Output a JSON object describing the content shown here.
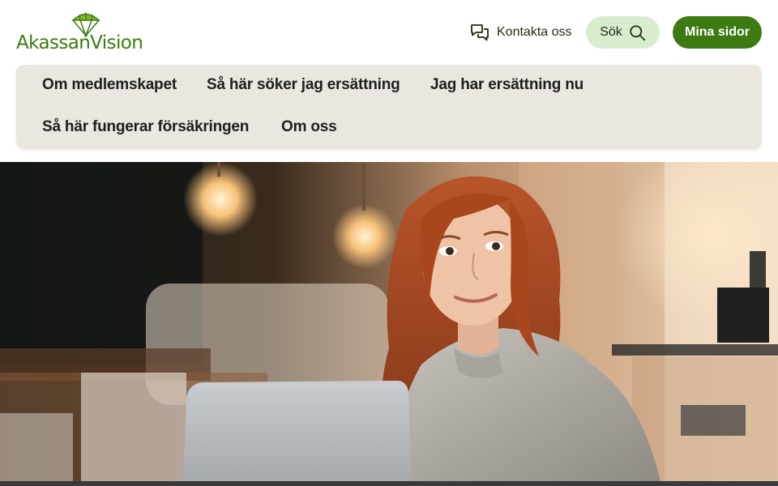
{
  "brand": {
    "name": "AkassanVision",
    "logo_icon": "parachute-icon",
    "color": "#3d7a12"
  },
  "header": {
    "contact": {
      "label": "Kontakta oss",
      "icon": "chat-bubbles-icon"
    },
    "search": {
      "label": "Sök",
      "icon": "search-icon"
    },
    "my_pages": {
      "label": "Mina sidor"
    }
  },
  "nav": {
    "items": [
      {
        "label": "Om medlemskapet"
      },
      {
        "label": "Så här söker jag ersättning"
      },
      {
        "label": "Jag har ersättning nu"
      },
      {
        "label": "Så här fungerar försäkringen"
      },
      {
        "label": "Om oss"
      }
    ]
  },
  "hero": {
    "image": "woman-with-laptop-in-cafe",
    "accent_colors": [
      "#c65a26",
      "#9a9690",
      "#2e2418"
    ]
  }
}
